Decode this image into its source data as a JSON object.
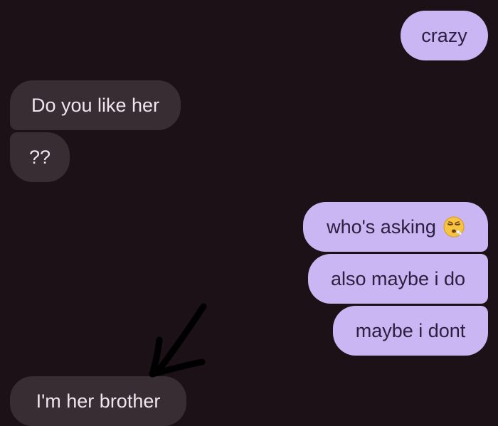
{
  "messages": [
    {
      "id": "m1",
      "direction": "outgoing",
      "text": "crazy"
    },
    {
      "id": "m2",
      "direction": "incoming",
      "text": "Do you like her"
    },
    {
      "id": "m3",
      "direction": "incoming",
      "text": "??"
    },
    {
      "id": "m4",
      "direction": "outgoing",
      "text": "who's asking",
      "emoji": "face-exhaling-emoji"
    },
    {
      "id": "m5",
      "direction": "outgoing",
      "text": "also maybe i do"
    },
    {
      "id": "m6",
      "direction": "outgoing",
      "text": "maybe i dont"
    },
    {
      "id": "m7",
      "direction": "incoming",
      "text": "I'm her brother"
    }
  ],
  "colors": {
    "background": "#1b1117",
    "incoming_bubble": "#372d33",
    "incoming_text": "#efe5ec",
    "outgoing_bubble": "#c9b6f2",
    "outgoing_text": "#2b2040",
    "annotation_arrow": "#000000"
  },
  "annotation": {
    "icon": "hand-drawn-arrow-icon"
  }
}
